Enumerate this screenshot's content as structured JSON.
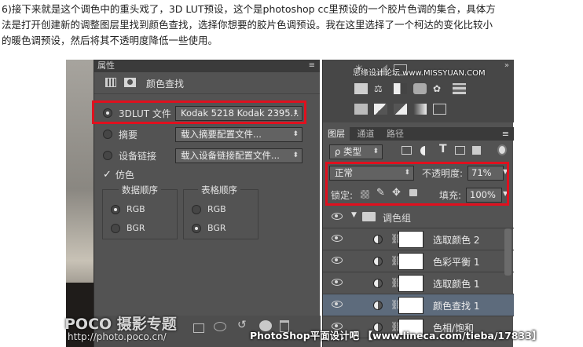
{
  "intro": {
    "line1": "6)接下来就是这个调色中的重头戏了，3D LUT预设，这个是photoshop cc里预设的一个胶片色调的集合，具体方",
    "line2": "法是打开创建新的调整图层里找到颜色查找，选择你想要的胶片色调预设。我在这里选择了一个柯达的变化比较小",
    "line3": "的暖色调预设，然后将其不透明度降低一些使用。"
  },
  "properties": {
    "panel_title": "属性",
    "adjustment_title": "颜色查找",
    "lut_label": "3DLUT 文件",
    "lut_value": "Kodak 5218 Kodak 2395...",
    "abstract_label": "摘要",
    "abstract_value": "载入摘要配置文件...",
    "devicelink_label": "设备链接",
    "devicelink_value": "载入设备链接配置文件...",
    "dither_label": "仿色",
    "data_order_title": "数据顺序",
    "table_order_title": "表格顺序",
    "rgb": "RGB",
    "bgr": "BGR"
  },
  "layers": {
    "watermark_top": "思缘设计论坛 www.MISSYUAN.COM",
    "tabs": [
      "图层",
      "通道",
      "路径"
    ],
    "filter_kind": "ρ 类型",
    "blend_mode": "正常",
    "opacity_label": "不透明度:",
    "opacity_value": "71%",
    "lock_label": "锁定:",
    "fill_label": "填充:",
    "fill_value": "100%",
    "group_name": "调色组",
    "items": [
      {
        "name": "选取颜色 2"
      },
      {
        "name": "色彩平衡 1"
      },
      {
        "name": "选取颜色 1"
      },
      {
        "name": "颜色查找 1"
      },
      {
        "name": "色相/饱和"
      }
    ]
  },
  "watermarks": {
    "poco_brand": "POCO 摄影专题",
    "poco_url": "http://photo.poco.cn/",
    "bottom_right": "PhotoShop平面设计吧 【www.lineca.com/tieba/17833】"
  },
  "colors": {
    "highlight": "#e0101e",
    "panel_bg": "#535353",
    "selected_layer": "#5d6b7c"
  }
}
